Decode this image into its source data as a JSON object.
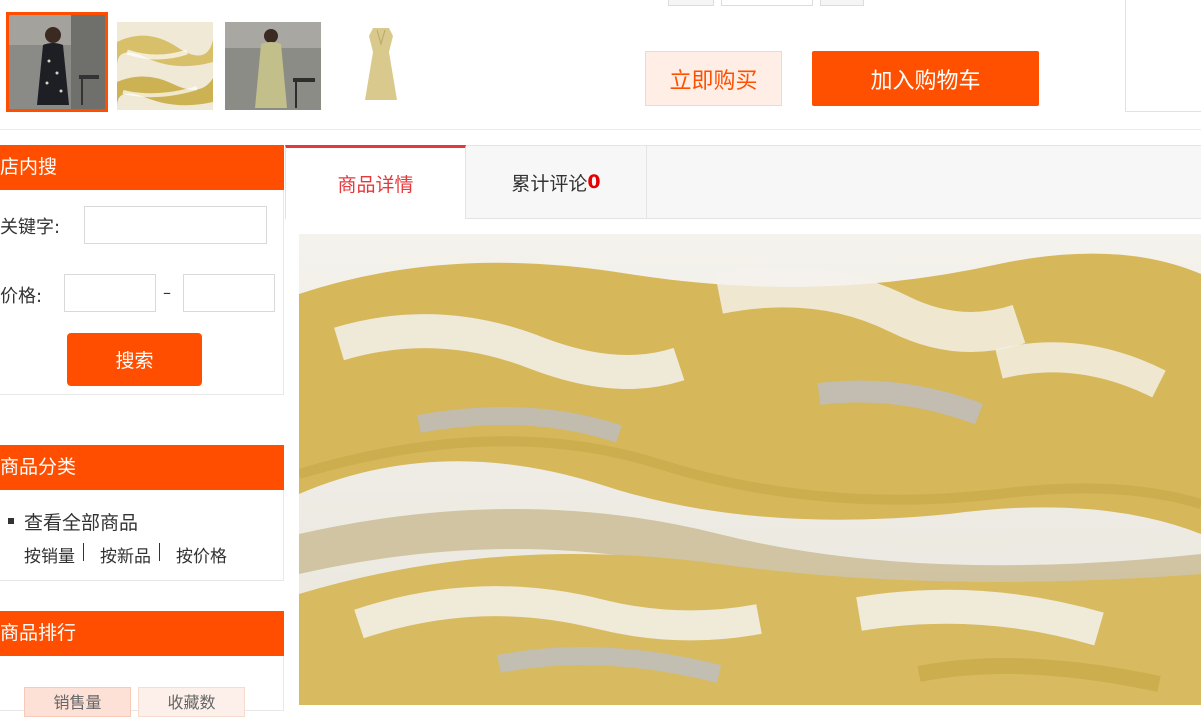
{
  "gallery": {
    "thumbnails": [
      {
        "alt": "model in black floral dress",
        "selected": true
      },
      {
        "alt": "yellow tie-dye fabric close-up",
        "selected": false
      },
      {
        "alt": "model in yellow dress",
        "selected": false
      },
      {
        "alt": "yellow dress flat lay",
        "selected": false
      }
    ]
  },
  "actions": {
    "buy_now": "立即购买",
    "add_to_cart": "加入购物车"
  },
  "store_search": {
    "title": "店内搜",
    "keyword_label": "关键字:",
    "keyword_value": "",
    "price_label": "价格:",
    "price_min": "",
    "price_max": "",
    "price_separator": "–",
    "search_button": "搜索"
  },
  "categories": {
    "title": "商品分类",
    "view_all": "查看全部商品",
    "sort_by_sales": "按销量",
    "sort_by_new": "按新品",
    "sort_by_price": "按价格"
  },
  "ranking": {
    "title": "商品排行",
    "tabs": [
      "销售量",
      "收藏数"
    ]
  },
  "detail_tabs": {
    "details": "商品详情",
    "reviews_label": "累计评论",
    "reviews_count": "0"
  },
  "colors": {
    "accent": "#ff4e00",
    "active_tab": "#e4393c",
    "fabric_yellow": "#d4b24a"
  }
}
